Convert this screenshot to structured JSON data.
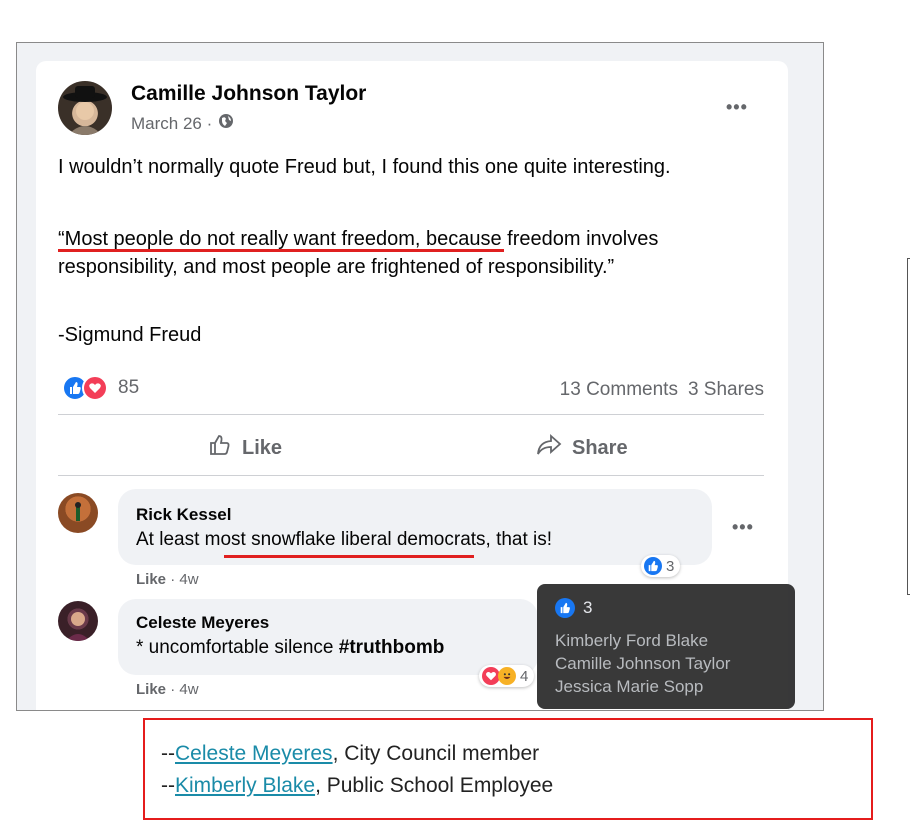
{
  "post": {
    "author": "Camille Johnson Taylor",
    "date": "March 26 ·",
    "privacy_icon": "globe-icon",
    "menu": "•••",
    "paragraphs": [
      "I wouldn’t normally quote Freud but, I found this one quite interesting.",
      "“Most people do not really want freedom, because freedom involves responsibility, and most people are frightened of responsibility.”",
      "-Sigmund Freud"
    ],
    "reaction_count": "85",
    "comments": "13 Comments",
    "shares": "3 Shares",
    "like_label": "Like",
    "share_label": "Share"
  },
  "comments": [
    {
      "name": "Rick Kessel",
      "text": "At least most snowflake liberal democrats, that is!",
      "like": "Like",
      "time": "· 4w",
      "reactions": "3",
      "menu": "•••"
    },
    {
      "name": "Celeste Meyeres",
      "text_plain": "* uncomfortable silence ",
      "text_bold": "#truthbomb",
      "like": "Like",
      "time": "· 4w",
      "reactions": "4"
    }
  ],
  "tooltip": {
    "count": "3",
    "names": [
      "Kimberly Ford Blake",
      "Camille Johnson Taylor",
      "Jessica Marie Sopp"
    ]
  },
  "caption": {
    "line1_prefix": "--",
    "line1_link": "Celeste Meyeres",
    "line1_rest": ", City Council member",
    "line2_prefix": "--",
    "line2_link": "Kimberly Blake",
    "line2_rest": ", Public School Employee"
  },
  "colors": {
    "like_blue": "#1877f2",
    "love_red": "#f33e58",
    "highlight_red": "#e02020",
    "link_teal": "#1a8ba8"
  }
}
